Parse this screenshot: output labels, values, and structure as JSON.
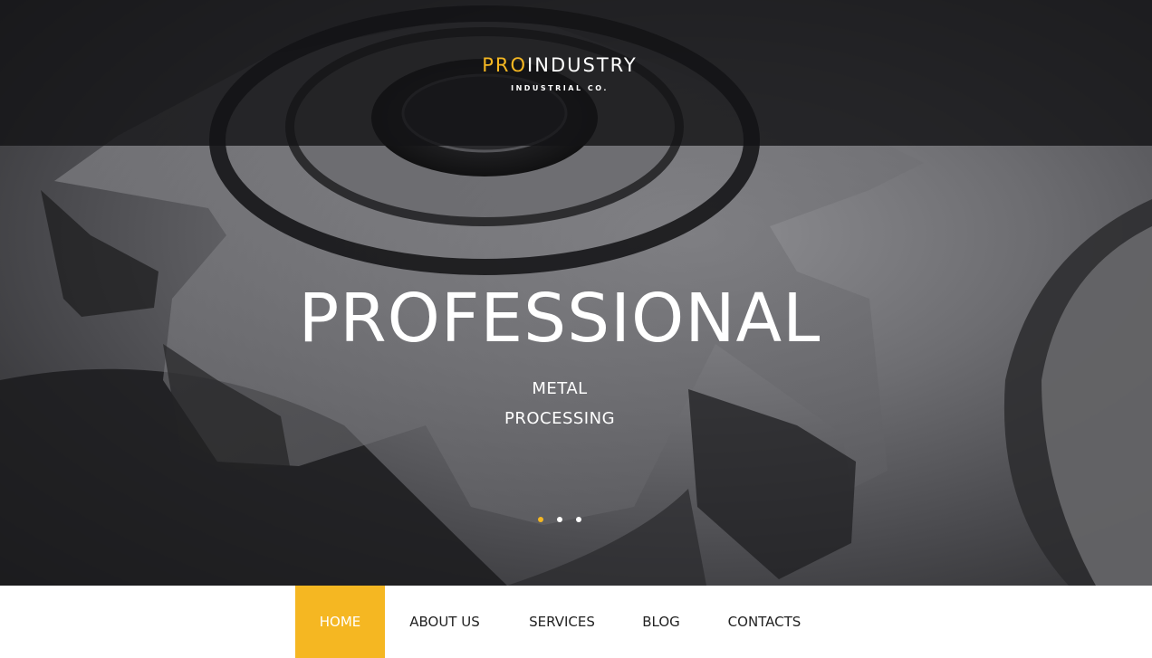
{
  "logo": {
    "accent_text": "PRO",
    "main_text": "INDUSTRY",
    "subtitle": "INDUSTRIAL CO."
  },
  "hero": {
    "headline": "PROFESSIONAL",
    "subline_1": "METAL",
    "subline_2": "PROCESSING",
    "slider_dots": [
      {
        "active": true
      },
      {
        "active": false
      },
      {
        "active": false
      }
    ]
  },
  "nav": {
    "items": [
      {
        "label": "HOME",
        "active": true
      },
      {
        "label": "ABOUT US",
        "active": false
      },
      {
        "label": "SERVICES",
        "active": false
      },
      {
        "label": "BLOG",
        "active": false
      },
      {
        "label": "CONTACTS",
        "active": false
      }
    ]
  },
  "colors": {
    "accent": "#f5b722",
    "topbar": "#141416",
    "text_dark": "#222222"
  }
}
